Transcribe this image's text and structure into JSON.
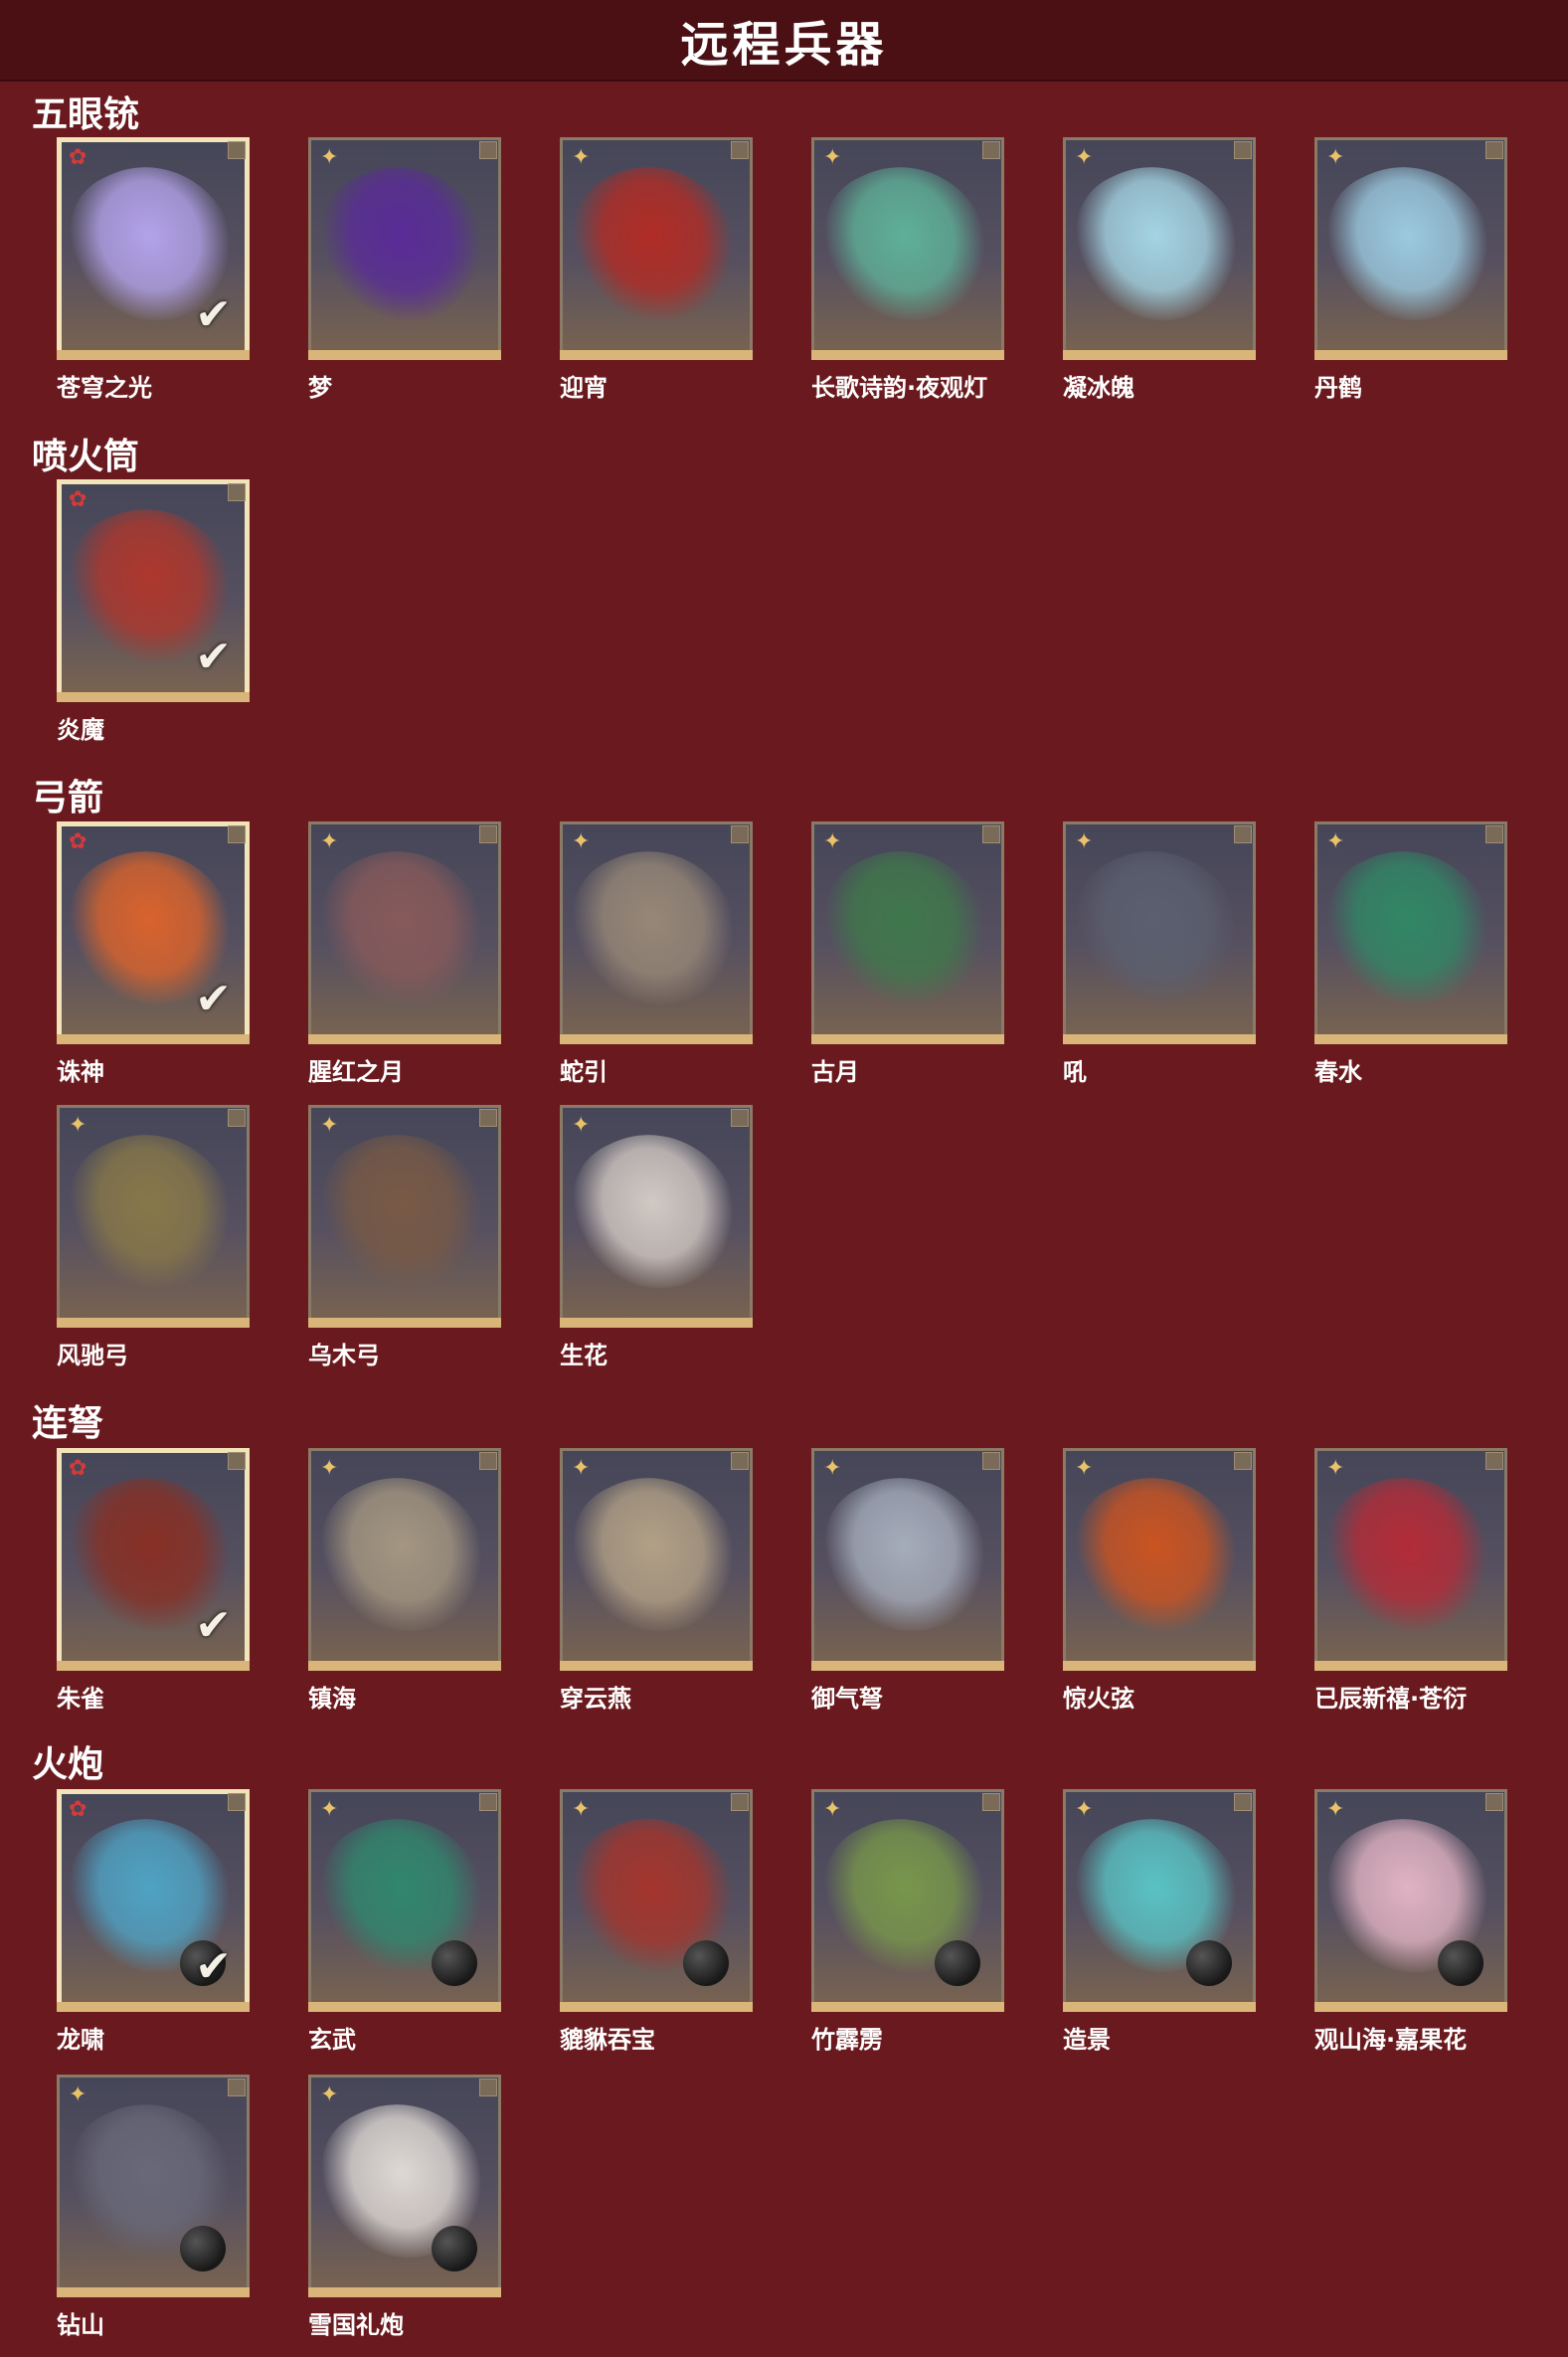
{
  "page": {
    "title": "远程兵器"
  },
  "sections": [
    {
      "name": "五眼铳",
      "items": [
        {
          "label": "苍穹之光",
          "equipped": true,
          "color": "#b7a6f0"
        },
        {
          "label": "梦",
          "equipped": false,
          "color": "#5a2a9a"
        },
        {
          "label": "迎宵",
          "equipped": false,
          "color": "#b52a22"
        },
        {
          "label": "长歌诗韵·夜观灯",
          "equipped": false,
          "color": "#5fb59a"
        },
        {
          "label": "凝冰魄",
          "equipped": false,
          "color": "#a8dbea"
        },
        {
          "label": "丹鹤",
          "equipped": false,
          "color": "#9fd0e6"
        }
      ]
    },
    {
      "name": "喷火筒",
      "items": [
        {
          "label": "炎魔",
          "equipped": true,
          "color": "#b2362a"
        }
      ]
    },
    {
      "name": "弓箭",
      "items": [
        {
          "label": "诛神",
          "equipped": true,
          "color": "#e0642a"
        },
        {
          "label": "腥红之月",
          "equipped": false,
          "color": "#8a5a5a"
        },
        {
          "label": "蛇引",
          "equipped": false,
          "color": "#9a8a78"
        },
        {
          "label": "古月",
          "equipped": false,
          "color": "#3f7a4a"
        },
        {
          "label": "吼",
          "equipped": false,
          "color": "#5c6070"
        },
        {
          "label": "春水",
          "equipped": false,
          "color": "#2f8a66"
        },
        {
          "label": "风驰弓",
          "equipped": false,
          "color": "#8a7a48"
        },
        {
          "label": "乌木弓",
          "equipped": false,
          "color": "#7a5a44"
        },
        {
          "label": "生花",
          "equipped": false,
          "color": "#d8cfc8"
        }
      ]
    },
    {
      "name": "连弩",
      "items": [
        {
          "label": "朱雀",
          "equipped": true,
          "color": "#8a2e22"
        },
        {
          "label": "镇海",
          "equipped": false,
          "color": "#a89a82"
        },
        {
          "label": "穿云燕",
          "equipped": false,
          "color": "#b7a588"
        },
        {
          "label": "御气弩",
          "equipped": false,
          "color": "#a9b1bf"
        },
        {
          "label": "惊火弦",
          "equipped": false,
          "color": "#d0541e"
        },
        {
          "label": "已辰新禧·苍衍",
          "equipped": false,
          "color": "#b82a36"
        }
      ]
    },
    {
      "name": "火炮",
      "items": [
        {
          "label": "龙啸",
          "equipped": true,
          "color": "#4fa7c9"
        },
        {
          "label": "玄武",
          "equipped": false,
          "color": "#2f8a6e"
        },
        {
          "label": "貔貅吞宝",
          "equipped": false,
          "color": "#a8342a"
        },
        {
          "label": "竹霹雳",
          "equipped": false,
          "color": "#7a9a4a"
        },
        {
          "label": "造景",
          "equipped": false,
          "color": "#5ac8c8"
        },
        {
          "label": "观山海·嘉果花",
          "equipped": false,
          "color": "#e8b8c8"
        },
        {
          "label": "钻山",
          "equipped": false,
          "color": "#6a6a7a"
        },
        {
          "label": "雪国礼炮",
          "equipped": false,
          "color": "#e6e0da"
        }
      ]
    }
  ],
  "icons": {
    "rank": "sparkle-icon",
    "equipped": "checkmark-icon",
    "cannonball": "cannonball-icon",
    "corner": "corner-badge-icon"
  }
}
